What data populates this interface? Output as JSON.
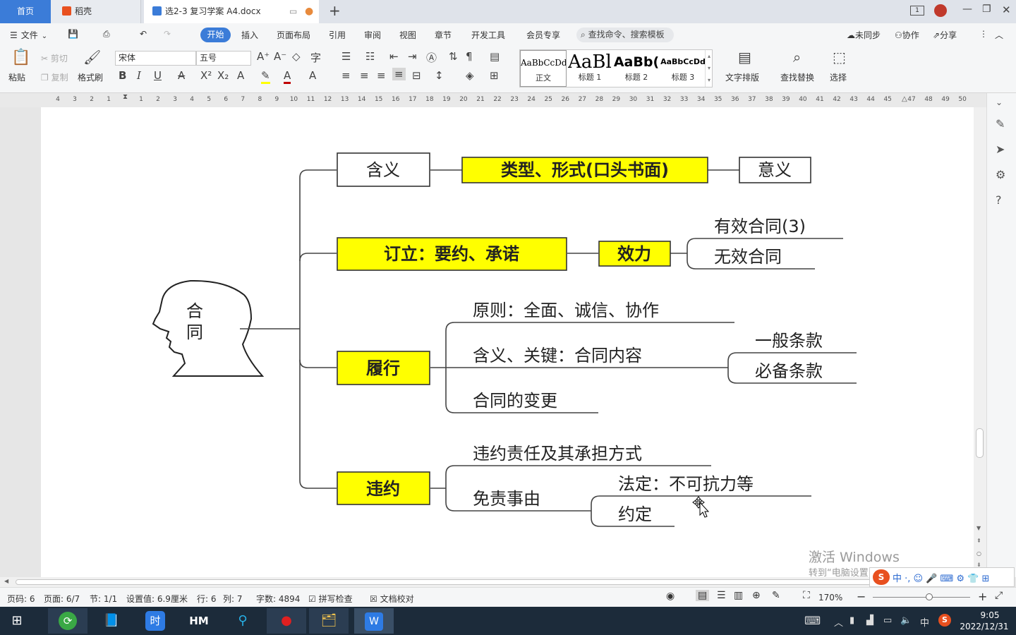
{
  "tabs": {
    "home": "首页",
    "daoke": "稻壳",
    "doc": "选2-3 复习学案 A4.docx"
  },
  "menu": {
    "file": "文件",
    "items": [
      "开始",
      "插入",
      "页面布局",
      "引用",
      "审阅",
      "视图",
      "章节",
      "开发工具",
      "会员专享"
    ],
    "search_placeholder": "查找命令、搜索模板",
    "sync": "未同步",
    "collab": "协作",
    "share": "分享"
  },
  "ribbon": {
    "paste": "粘贴",
    "cut": "剪切",
    "copy": "复制",
    "format_painter": "格式刷",
    "font_name": "宋体",
    "font_size": "五号",
    "styles": [
      {
        "preview": "AaBbCcDd",
        "name": "正文"
      },
      {
        "preview": "AaBl",
        "name": "标题 1"
      },
      {
        "preview": "AaBb(",
        "name": "标题 2"
      },
      {
        "preview": "AaBbCcDd",
        "name": "标题 3"
      }
    ],
    "text_layout": "文字排版",
    "find_replace": "查找替换",
    "select": "选择"
  },
  "ruler": {
    "left_numbers": [
      "4",
      "3",
      "2",
      "1"
    ],
    "numbers": [
      "1",
      "2",
      "3",
      "4",
      "5",
      "6",
      "7",
      "8",
      "9",
      "10",
      "11",
      "12",
      "13",
      "14",
      "15",
      "16",
      "17",
      "18",
      "19",
      "20",
      "21",
      "22",
      "23",
      "24",
      "25",
      "26",
      "27",
      "28",
      "29",
      "30",
      "31",
      "32",
      "33",
      "34",
      "35",
      "36",
      "37",
      "38",
      "39",
      "40",
      "41",
      "42",
      "43",
      "44",
      "45"
    ],
    "right_numbers": [
      "47",
      "48",
      "49",
      "50"
    ]
  },
  "mindmap": {
    "root": "合同",
    "branches": [
      {
        "label": "含义",
        "next": "类型、形式(口头书面)",
        "end": "意义"
      },
      {
        "label": "订立：要约、承诺",
        "next": "效力",
        "leaves": [
          "有效合同(3)",
          "无效合同"
        ]
      },
      {
        "label": "履行",
        "leaves": [
          "原则：全面、诚信、协作",
          "含义、关键：合同内容",
          "合同的变更"
        ],
        "subleaves": [
          "一般条款",
          "必备条款"
        ]
      },
      {
        "label": "违约",
        "leaves": [
          "违约责任及其承担方式",
          "免责事由"
        ],
        "subleaves": [
          "法定：不可抗力等",
          "约定"
        ]
      }
    ]
  },
  "watermark": {
    "line1": "激活 Windows",
    "line2": "转到“电脑设置”以激活 Windows。"
  },
  "status": {
    "page_code": "页码: 6",
    "page": "页面: 6/7",
    "section": "节: 1/1",
    "setting": "设置值: 6.9厘米",
    "row": "行: 6",
    "col": "列: 7",
    "words": "字数: 4894",
    "spellcheck": "拼写检查",
    "doc_check": "文档校对",
    "zoom": "170%"
  },
  "taskbar": {
    "time": "9:05",
    "date": "2022/12/31",
    "ime": "中"
  },
  "colors": {
    "accent": "#3b7cd8",
    "highlight": "#ffff00"
  }
}
